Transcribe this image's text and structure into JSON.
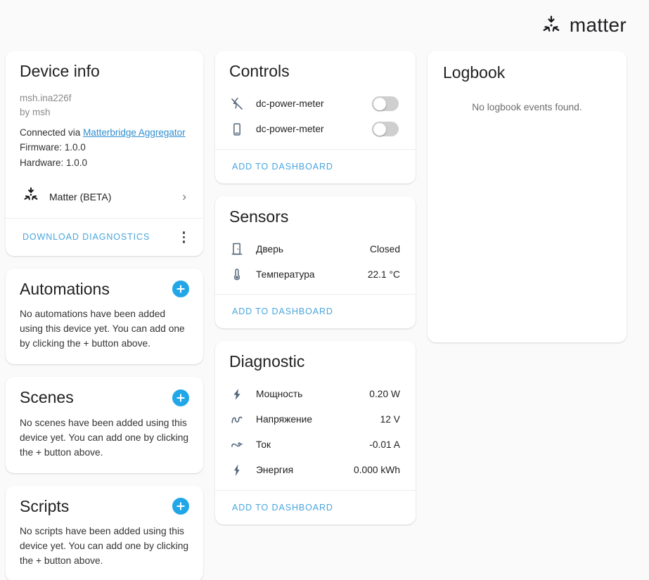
{
  "header": {
    "brand_name": "matter",
    "brand_mark_icon": "matter-logo-icon"
  },
  "device_info": {
    "title": "Device info",
    "model": "msh.ina226f",
    "manufacturer": "by msh",
    "connected_via_prefix": "Connected via ",
    "connected_via_link": "Matterbridge Aggregator",
    "firmware": "Firmware: 1.0.0",
    "hardware": "Hardware: 1.0.0",
    "integration_label": "Matter (BETA)",
    "integration_icon": "matter-logo-icon",
    "chevron_icon": "chevron-right-icon",
    "download_diagnostics_label": "Download diagnostics",
    "overflow_icon": "more-vertical-icon"
  },
  "automations": {
    "title": "Automations",
    "empty_text": "No automations have been added using this device yet. You can add one by clicking the + button above.",
    "add_icon": "plus-icon"
  },
  "scenes": {
    "title": "Scenes",
    "empty_text": "No scenes have been added using this device yet. You can add one by clicking the + button above.",
    "add_icon": "plus-icon"
  },
  "scripts": {
    "title": "Scripts",
    "empty_text": "No scripts have been added using this device yet. You can add one by clicking the + button above.",
    "add_icon": "plus-icon"
  },
  "controls": {
    "title": "Controls",
    "add_to_dashboard_label": "Add to dashboard",
    "rows": [
      {
        "name": "dc-power-meter",
        "icon": "flash-off-icon",
        "toggle": "off"
      },
      {
        "name": "dc-power-meter",
        "icon": "tablet-icon",
        "toggle": "off"
      }
    ]
  },
  "sensors": {
    "title": "Sensors",
    "add_to_dashboard_label": "Add to dashboard",
    "rows": [
      {
        "name": "Дверь",
        "value": "Closed",
        "icon": "door-icon"
      },
      {
        "name": "Температура",
        "value": "22.1 °C",
        "icon": "thermometer-icon"
      }
    ]
  },
  "diagnostic": {
    "title": "Diagnostic",
    "add_to_dashboard_label": "Add to dashboard",
    "rows": [
      {
        "name": "Мощность",
        "value": "0.20 W",
        "icon": "flash-icon"
      },
      {
        "name": "Напряжение",
        "value": "12 V",
        "icon": "sine-wave-icon"
      },
      {
        "name": "Ток",
        "value": "-0.01 A",
        "icon": "current-ac-icon"
      },
      {
        "name": "Энергия",
        "value": "0.000 kWh",
        "icon": "lightning-bolt-icon"
      }
    ]
  },
  "logbook": {
    "title": "Logbook",
    "empty_text": "No logbook events found."
  },
  "colors": {
    "accent_blue": "#21a7e8",
    "link_blue": "#48a5dd",
    "background": "#fafafa",
    "card": "#ffffff",
    "icon_gray": "#53657a"
  }
}
